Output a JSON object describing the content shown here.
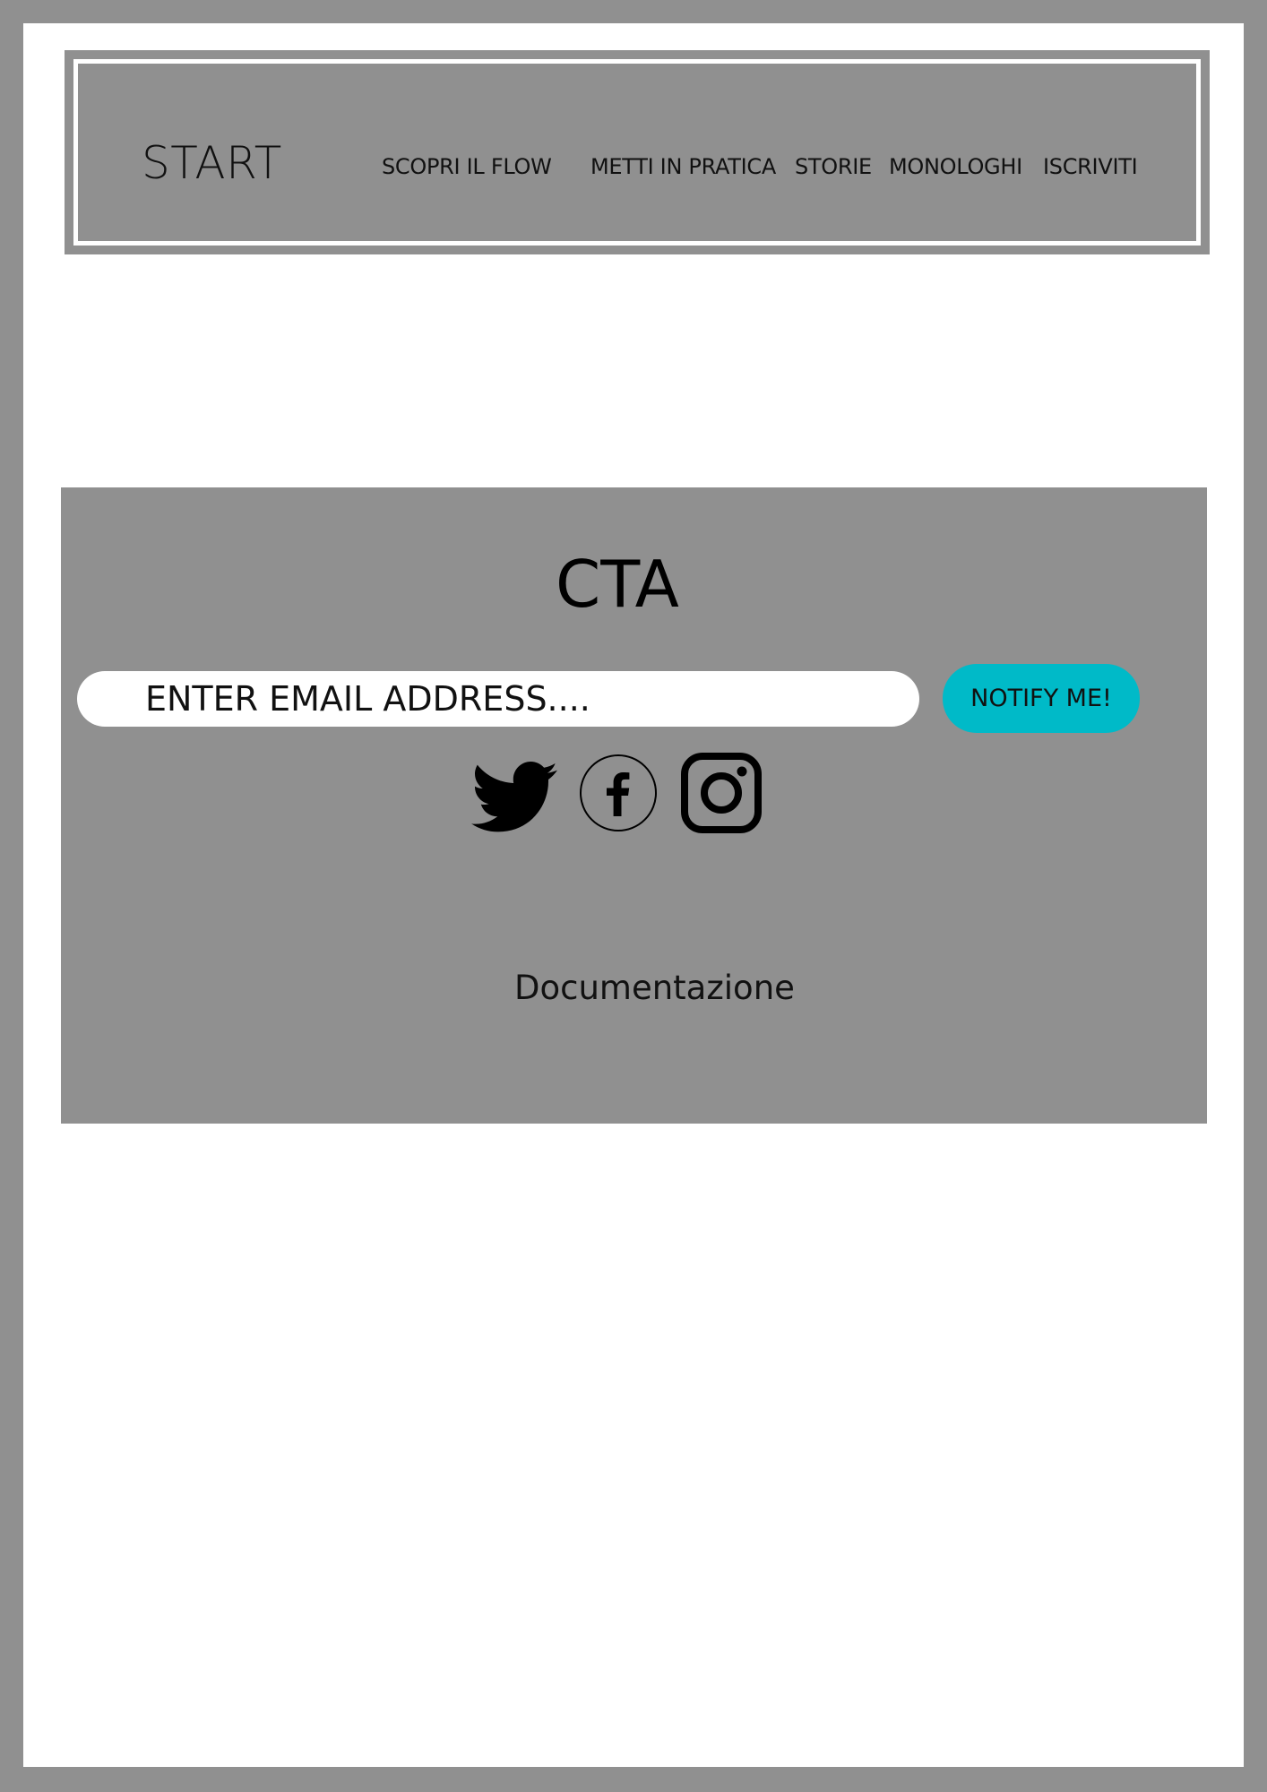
{
  "header": {
    "logo_text": "START",
    "nav": [
      {
        "label": "SCOPRI IL FLOW"
      },
      {
        "label": "METTI IN PRATICA"
      },
      {
        "label": "STORIE"
      },
      {
        "label": "MONOLOGHI"
      },
      {
        "label": "ISCRIVITI"
      }
    ]
  },
  "cta": {
    "title": "CTA",
    "email_placeholder": "ENTER EMAIL ADDRESS....",
    "notify_label": "NOTIFY ME!",
    "social_icons": [
      "twitter-icon",
      "facebook-icon",
      "instagram-icon"
    ],
    "docs_link": "Documentazione"
  },
  "colors": {
    "frame_gray": "#909090",
    "accent_cyan": "#00bac8",
    "white": "#ffffff"
  }
}
